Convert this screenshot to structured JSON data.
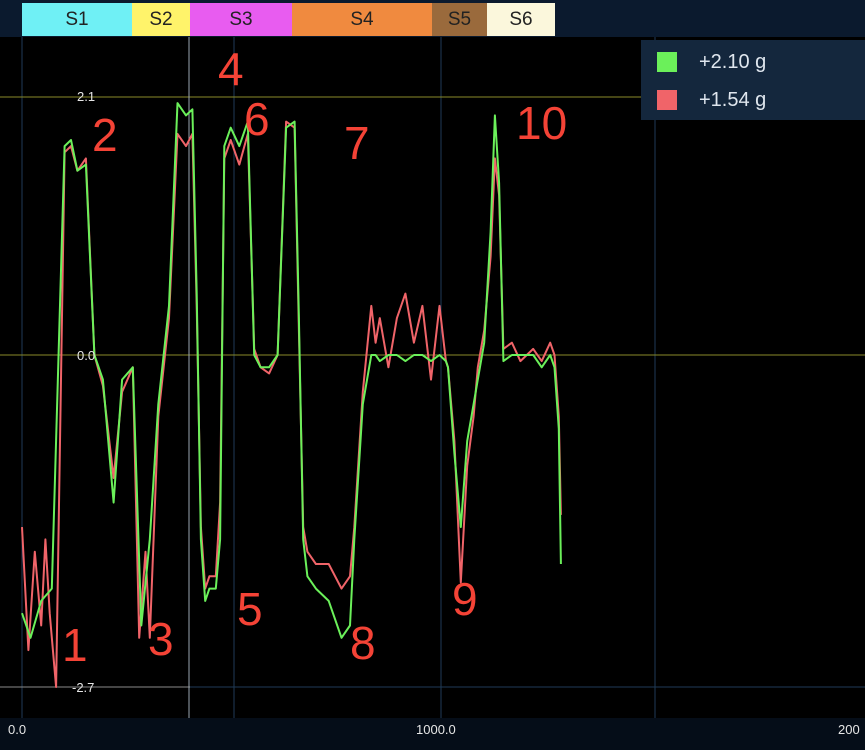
{
  "segments": [
    {
      "label": "S1",
      "color": "#6ff0f5"
    },
    {
      "label": "S2",
      "color": "#fff36a"
    },
    {
      "label": "S3",
      "color": "#e85cf0"
    },
    {
      "label": "S4",
      "color": "#f08a3f"
    },
    {
      "label": "S5",
      "color": "#9a6a3c"
    },
    {
      "label": "S6",
      "color": "#fbf7dc"
    }
  ],
  "legend": [
    {
      "label": "+2.10 g",
      "color": "#6bf05a"
    },
    {
      "label": "+1.54 g",
      "color": "#f06469"
    }
  ],
  "annotations": [
    "1",
    "2",
    "3",
    "4",
    "5",
    "6",
    "7",
    "8",
    "9",
    "10"
  ],
  "chart_data": {
    "type": "line",
    "xlim": [
      0,
      2000
    ],
    "ylim": [
      -2.7,
      2.1
    ],
    "y_ticks": [
      "2.1",
      "0.0",
      "-2.7"
    ],
    "x_ticks": [
      "0.0",
      "1000.0",
      "200"
    ],
    "grid": true,
    "legend_placement": "top-right",
    "series": [
      {
        "name": "+2.10 g",
        "x": [
          0,
          20,
          45,
          70,
          100,
          115,
          130,
          150,
          170,
          190,
          215,
          235,
          260,
          280,
          300,
          320,
          345,
          365,
          385,
          400,
          410,
          420,
          430,
          440,
          455,
          465,
          475,
          490,
          510,
          530,
          545,
          560,
          580,
          600,
          620,
          640,
          650,
          660,
          670,
          690,
          720,
          750,
          770,
          780,
          800,
          820,
          830,
          840,
          860,
          880,
          900,
          920,
          940,
          960,
          980,
          995,
          1000,
          1015,
          1030,
          1045,
          1060,
          1070,
          1085,
          1100,
          1110,
          1120,
          1130,
          1150,
          1170,
          1200,
          1220,
          1240,
          1250,
          1260,
          1265
        ],
        "y": [
          -2.1,
          -2.3,
          -2.0,
          -1.9,
          1.7,
          1.75,
          1.5,
          1.55,
          0.0,
          -0.2,
          -1.2,
          -0.2,
          -0.1,
          -2.2,
          -1.5,
          -0.4,
          0.4,
          2.05,
          1.95,
          2.0,
          0.5,
          -1.5,
          -2.0,
          -1.9,
          -1.9,
          -1.5,
          1.7,
          1.85,
          1.7,
          1.9,
          0.0,
          -0.1,
          -0.1,
          0.0,
          1.85,
          1.9,
          0.3,
          -1.5,
          -1.8,
          -1.9,
          -2.0,
          -2.3,
          -2.2,
          -1.5,
          -0.4,
          0.0,
          0.0,
          -0.05,
          0.0,
          0.0,
          -0.05,
          0.0,
          0.0,
          -0.05,
          0.0,
          -0.05,
          -0.1,
          -0.8,
          -1.4,
          -0.7,
          -0.4,
          -0.2,
          0.1,
          1.0,
          1.95,
          1.4,
          -0.05,
          0.0,
          0.0,
          0.0,
          -0.1,
          0.0,
          -0.1,
          -0.6,
          -1.7
        ]
      },
      {
        "name": "+1.54 g",
        "x": [
          0,
          15,
          30,
          45,
          55,
          65,
          80,
          100,
          115,
          130,
          150,
          170,
          190,
          215,
          235,
          260,
          275,
          290,
          300,
          320,
          345,
          365,
          385,
          400,
          410,
          420,
          430,
          440,
          455,
          465,
          475,
          490,
          510,
          530,
          545,
          560,
          580,
          600,
          620,
          640,
          650,
          660,
          670,
          690,
          720,
          750,
          770,
          780,
          800,
          820,
          830,
          840,
          860,
          880,
          900,
          920,
          940,
          960,
          980,
          995,
          1000,
          1015,
          1030,
          1045,
          1060,
          1070,
          1085,
          1100,
          1110,
          1120,
          1130,
          1150,
          1170,
          1200,
          1220,
          1240,
          1250,
          1260,
          1265
        ],
        "y": [
          -1.4,
          -2.4,
          -1.6,
          -2.2,
          -1.5,
          -2.1,
          -2.7,
          1.65,
          1.7,
          1.5,
          1.6,
          0.0,
          -0.25,
          -1.0,
          -0.3,
          -0.1,
          -2.3,
          -1.6,
          -2.3,
          -0.5,
          0.3,
          1.8,
          1.7,
          1.8,
          0.4,
          -1.4,
          -1.9,
          -1.8,
          -1.8,
          -1.2,
          1.6,
          1.75,
          1.55,
          1.8,
          0.05,
          -0.1,
          -0.15,
          0.0,
          1.9,
          1.85,
          0.2,
          -1.4,
          -1.6,
          -1.7,
          -1.7,
          -1.9,
          -1.8,
          -1.4,
          -0.3,
          0.4,
          0.1,
          0.3,
          -0.1,
          0.3,
          0.5,
          0.1,
          0.4,
          -0.2,
          0.4,
          -0.05,
          -0.1,
          -0.7,
          -1.85,
          -0.9,
          -0.5,
          -0.1,
          0.2,
          0.8,
          1.6,
          1.3,
          0.05,
          0.1,
          -0.05,
          0.05,
          -0.05,
          0.1,
          0.0,
          -0.5,
          -1.3
        ]
      }
    ]
  }
}
